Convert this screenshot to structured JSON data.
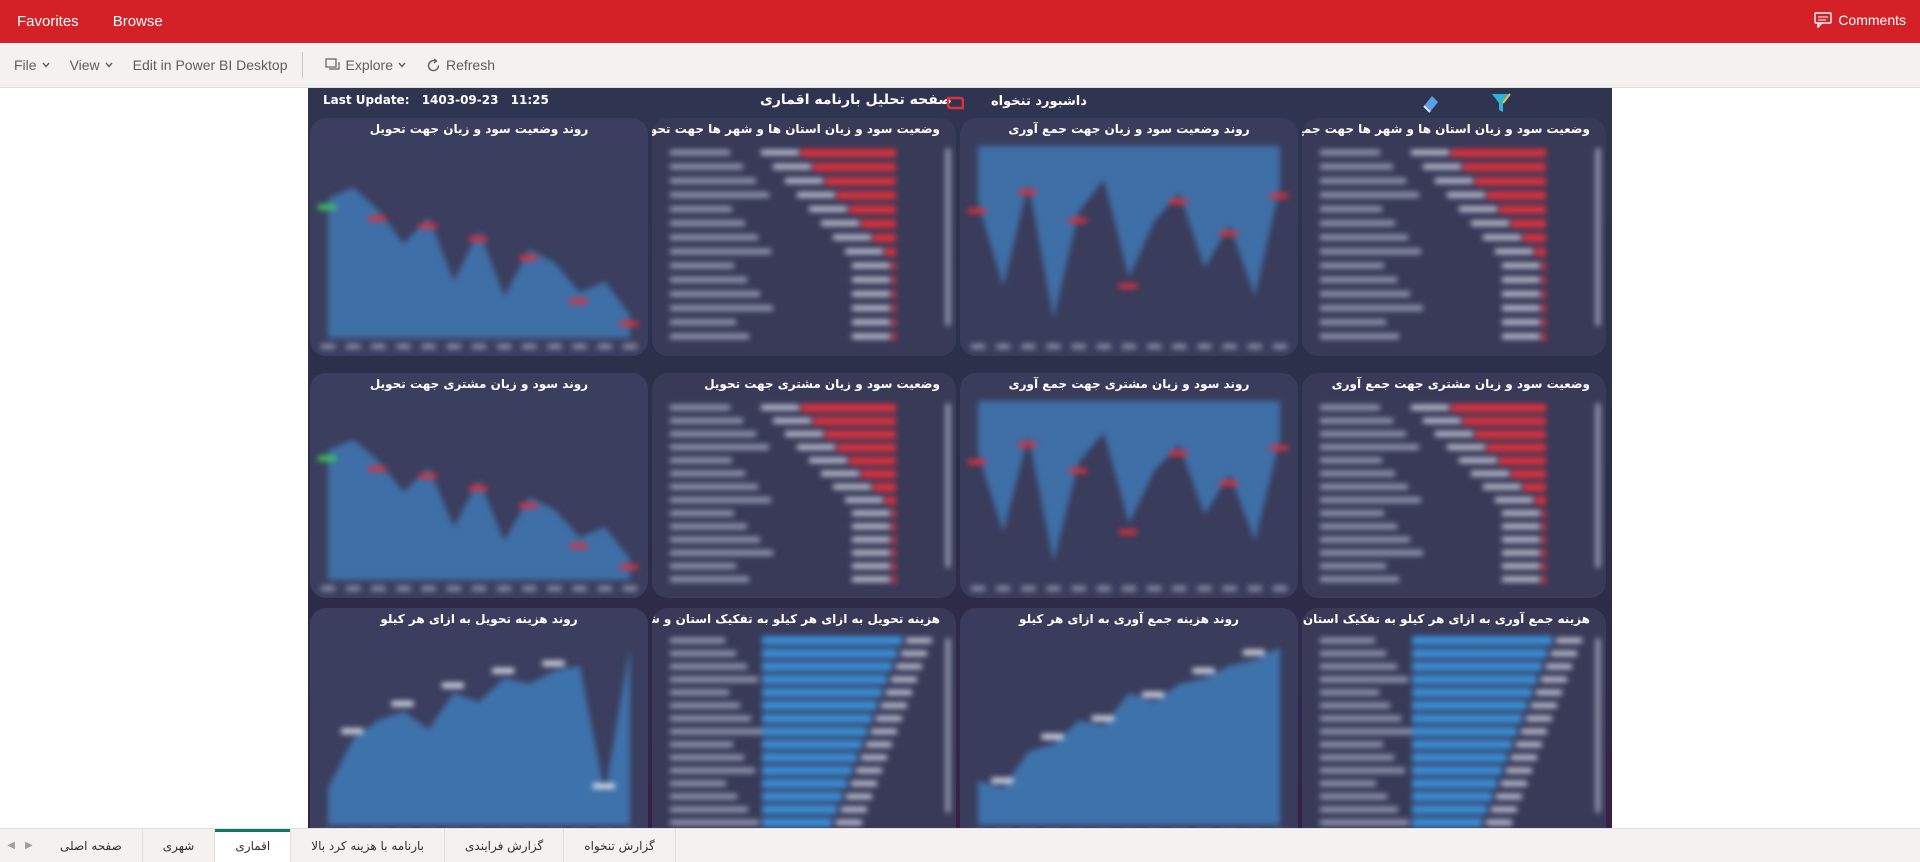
{
  "topbar": {
    "favorites": "Favorites",
    "browse": "Browse",
    "comments": "Comments"
  },
  "toolbar": {
    "file": "File",
    "view": "View",
    "edit": "Edit in Power BI Desktop",
    "explore": "Explore",
    "refresh": "Refresh"
  },
  "report": {
    "last_update_label": "Last Update:",
    "last_update_date": "1403-09-23",
    "last_update_time": "11:25",
    "title": "صفحه تحلیل بارنامه اقماری",
    "subtitle": "داشبورد  تنخواه",
    "panels": [
      {
        "title": "روند وضعیت سود و زیان جهت تحویل",
        "kind": "area",
        "bg": "#3b3e5e"
      },
      {
        "title": "وضعیت سود و زیان استان ها و شهر ها جهت تحویل",
        "kind": "redbar",
        "bg": "#383a58"
      },
      {
        "title": "روند وضعیت سود و زیان جهت جمع آوری",
        "kind": "area-inv",
        "bg": "#3a3c5b"
      },
      {
        "title": "وضعیت سود و زیان استان ها و شهر ها جهت جمع آوری",
        "kind": "redbar2",
        "bg": "#383a58"
      },
      {
        "title": "روند سود و زیان مشتری جهت تحویل",
        "kind": "area",
        "bg": "#3b3e5e"
      },
      {
        "title": "وضعیت سود و زیان مشتری جهت تحویل",
        "kind": "redbar",
        "bg": "#383a58"
      },
      {
        "title": "روند سود و زیان مشتری جهت جمع آوری",
        "kind": "area-inv",
        "bg": "#3a3c5b"
      },
      {
        "title": "وضعیت سود و زیان مشتری جهت جمع آوری",
        "kind": "redbar2",
        "bg": "#383a58"
      },
      {
        "title": "روند هزینه تحویل به ازای هر کیلو",
        "kind": "cost",
        "bg": "#3b3e5e"
      },
      {
        "title": "هزینه تحویل به ازای هر کیلو به تفکیک استان و شهر",
        "kind": "bluebar",
        "bg": "#383a58"
      },
      {
        "title": "روند هزینه جمع آوری به ازای هر کیلو",
        "kind": "cost2",
        "bg": "#3a3c5b"
      },
      {
        "title": "هزینه جمع آوری به ازای هر کیلو به تفکیک استان و شهر",
        "kind": "bluebar2",
        "bg": "#383a58"
      }
    ]
  },
  "tabs": [
    {
      "label": "صفحه اصلی",
      "active": false
    },
    {
      "label": "شهری",
      "active": false
    },
    {
      "label": "اقماری",
      "active": true
    },
    {
      "label": "بارنامه با هزینه کرد بالا",
      "active": false
    },
    {
      "label": "گزارش فرایندی",
      "active": false
    },
    {
      "label": "گزارش تنخواه",
      "active": false
    }
  ],
  "colors": {
    "brand_red": "#d32127",
    "canvas": "#2f3550",
    "active_tab": "#117865",
    "bar_red": "#e0303c",
    "bar_blue": "#3a8fd8",
    "area_blue": "#3f78b4"
  }
}
